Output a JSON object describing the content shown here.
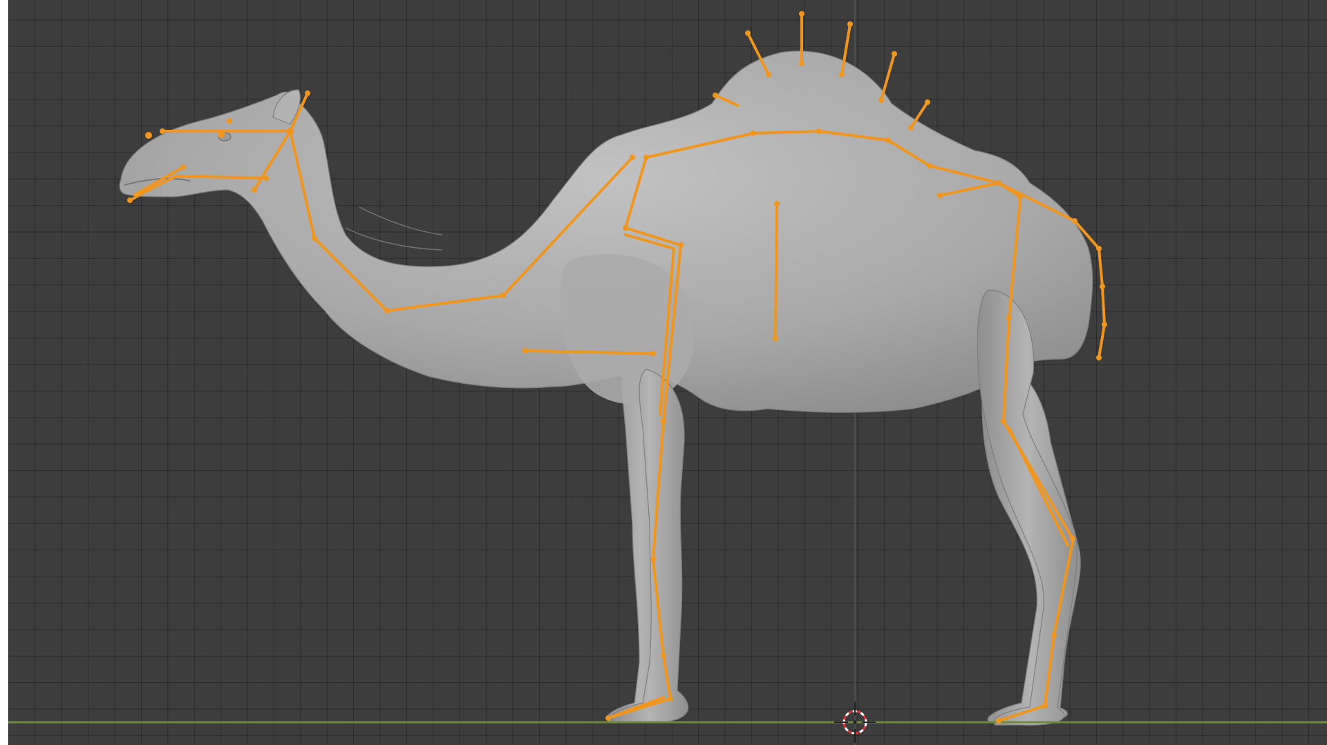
{
  "viewport": {
    "label": "",
    "background_color": "#3d3d3d",
    "grid_color": "#2f2f2f",
    "ground_axis_color": "#6e8a3a",
    "vertical_axis_color": "#555555"
  },
  "model": {
    "object": "camel-mesh",
    "mesh_color": "#a9a9a9",
    "rendered_as": "solid-shaded"
  },
  "armature": {
    "color": "#f0961e",
    "selected": true
  },
  "cursor_3d": {
    "icon": "3d-cursor-icon",
    "ring_color_a": "#e03030",
    "ring_color_b": "#ffffff"
  }
}
